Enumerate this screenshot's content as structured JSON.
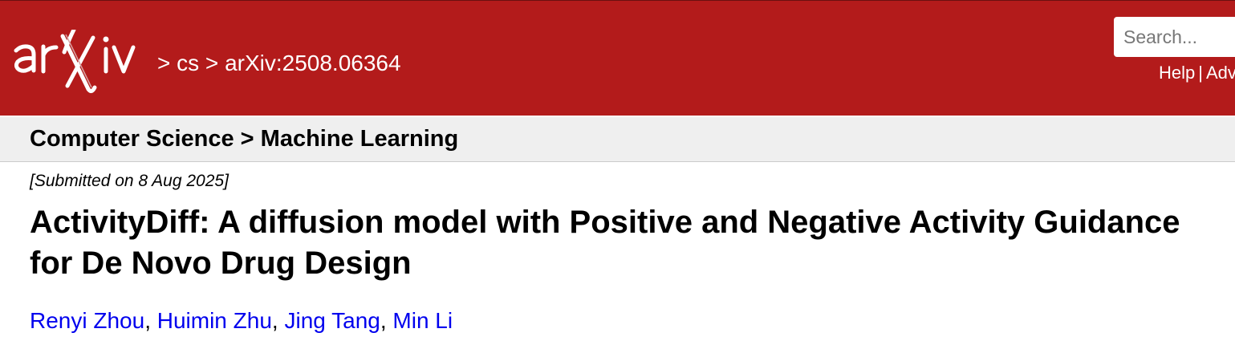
{
  "header": {
    "logo_text": "arXiv",
    "breadcrumb": {
      "sep1": ">",
      "category": "cs",
      "sep2": ">",
      "paper_id": "arXiv:2508.06364"
    },
    "search": {
      "placeholder": "Search..."
    },
    "links": {
      "help": "Help",
      "separator": "|",
      "advanced": "Adv"
    }
  },
  "subject_bar": {
    "text": "Computer Science > Machine Learning"
  },
  "paper": {
    "submitted": "[Submitted on 8 Aug 2025]",
    "title": "ActivityDiff: A diffusion model with Positive and Negative Activity Guidance for De Novo Drug Design",
    "authors": [
      "Renyi Zhou",
      "Huimin Zhu",
      "Jing Tang",
      "Min Li"
    ],
    "author_separator": ", "
  },
  "colors": {
    "header_bg": "#b31b1b",
    "subject_bar_bg": "#efefef",
    "link": "#0000ee"
  }
}
